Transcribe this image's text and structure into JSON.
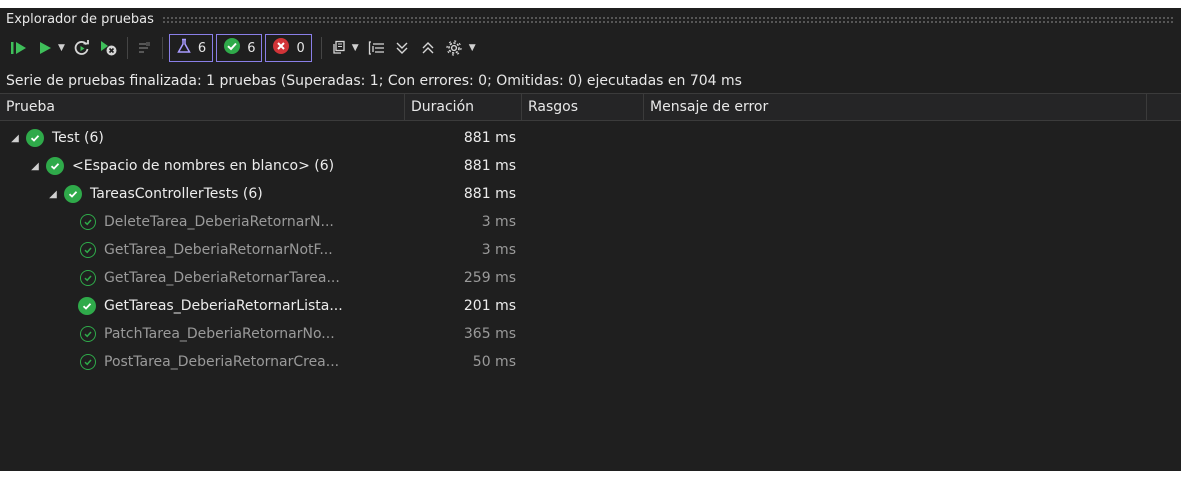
{
  "window": {
    "title": "Explorador de pruebas"
  },
  "toolbar": {
    "counts": {
      "total": "6",
      "passed": "6",
      "failed": "0"
    },
    "icons": [
      "run-all-icon",
      "run-icon",
      "dropdown-caret-icon",
      "repeat-last-run-icon",
      "cancel-run-icon",
      "filter-icon",
      "flask-icon",
      "passed-icon",
      "failed-icon",
      "playlist-icon",
      "group-by-icon",
      "expand-all-icon",
      "collapse-all-icon",
      "settings-icon"
    ]
  },
  "status": {
    "summary": "Serie de pruebas finalizada: 1 pruebas (Superadas: 1; Con errores: 0; Omitidas: 0) ejecutadas en 704 ms"
  },
  "columns": {
    "test": "Prueba",
    "duration": "Duración",
    "traits": "Rasgos",
    "error": "Mensaje de error"
  },
  "tree": [
    {
      "name": "Test (6)",
      "duration": "881 ms"
    },
    {
      "name": "<Espacio de nombres en blanco> (6)",
      "duration": "881 ms"
    },
    {
      "name": "TareasControllerTests (6)",
      "duration": "881 ms"
    },
    {
      "name": "DeleteTarea_DeberiaRetornarN...",
      "duration": "3 ms"
    },
    {
      "name": "GetTarea_DeberiaRetornarNotF...",
      "duration": "3 ms"
    },
    {
      "name": "GetTarea_DeberiaRetornarTarea...",
      "duration": "259 ms"
    },
    {
      "name": "GetTareas_DeberiaRetornarLista...",
      "duration": "201 ms"
    },
    {
      "name": "PatchTarea_DeberiaRetornarNo...",
      "duration": "365 ms"
    },
    {
      "name": "PostTarea_DeberiaRetornarCrea...",
      "duration": "50 ms"
    }
  ],
  "colors": {
    "passed": "#2faa4a",
    "failed": "#d13438",
    "accent": "#8a7fe8",
    "panel": "#1f1f1f"
  }
}
